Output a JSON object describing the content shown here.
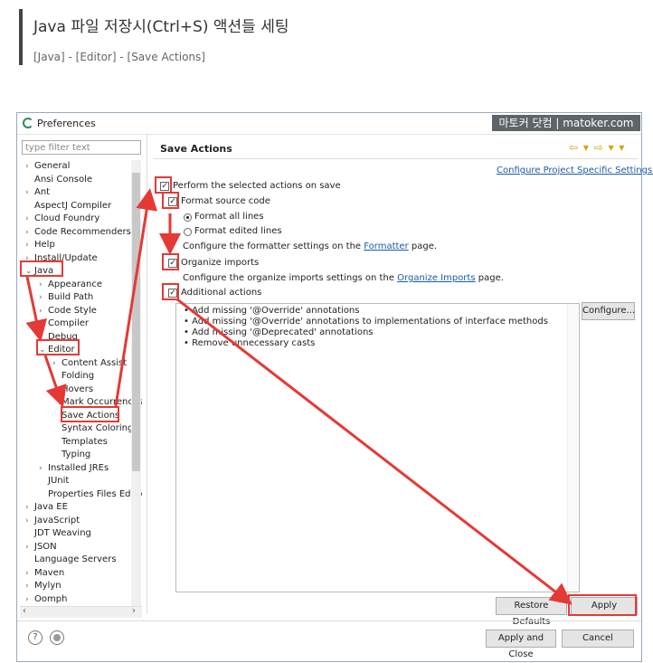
{
  "blog": {
    "title": "Java 파일 저장시(Ctrl+S) 액션들 세팅",
    "breadcrumb": "[Java] - [Editor] - [Save Actions]"
  },
  "window": {
    "title": "Preferences",
    "watermark": "마토커 닷컴 | matoker.com"
  },
  "sidebar": {
    "filter_placeholder": "type filter text",
    "items": [
      {
        "label": "General",
        "toggle": ">"
      },
      {
        "label": "Ansi Console",
        "toggle": ""
      },
      {
        "label": "Ant",
        "toggle": ">"
      },
      {
        "label": "AspectJ Compiler",
        "toggle": ""
      },
      {
        "label": "Cloud Foundry",
        "toggle": ">"
      },
      {
        "label": "Code Recommenders",
        "toggle": ">"
      },
      {
        "label": "Help",
        "toggle": ">"
      },
      {
        "label": "Install/Update",
        "toggle": ">"
      },
      {
        "label": "Java",
        "toggle": "v"
      },
      {
        "label": "Appearance",
        "toggle": ">"
      },
      {
        "label": "Build Path",
        "toggle": ">"
      },
      {
        "label": "Code Style",
        "toggle": ">"
      },
      {
        "label": "Compiler",
        "toggle": ">"
      },
      {
        "label": "Debug",
        "toggle": ">"
      },
      {
        "label": "Editor",
        "toggle": "v"
      },
      {
        "label": "Content Assist",
        "toggle": ">"
      },
      {
        "label": "Folding",
        "toggle": ""
      },
      {
        "label": "Hovers",
        "toggle": ""
      },
      {
        "label": "Mark Occurrences",
        "toggle": ""
      },
      {
        "label": "Save Actions",
        "toggle": ""
      },
      {
        "label": "Syntax Coloring",
        "toggle": ""
      },
      {
        "label": "Templates",
        "toggle": ""
      },
      {
        "label": "Typing",
        "toggle": ""
      },
      {
        "label": "Installed JREs",
        "toggle": ">"
      },
      {
        "label": "JUnit",
        "toggle": ""
      },
      {
        "label": "Properties Files Editor",
        "toggle": ""
      },
      {
        "label": "Java EE",
        "toggle": ">"
      },
      {
        "label": "JavaScript",
        "toggle": ">"
      },
      {
        "label": "JDT Weaving",
        "toggle": ""
      },
      {
        "label": "JSON",
        "toggle": ">"
      },
      {
        "label": "Language Servers",
        "toggle": ""
      },
      {
        "label": "Maven",
        "toggle": ">"
      },
      {
        "label": "Mylyn",
        "toggle": ">"
      },
      {
        "label": "Oomph",
        "toggle": ">"
      }
    ]
  },
  "main": {
    "title": "Save Actions",
    "nav": "⇦ ▾ ⇨ ▾ ▾",
    "configure_project_link": "Configure Project Specific Settings...",
    "perform_label": "Perform the selected actions on save",
    "format_label": "Format source code",
    "format_all_label": "Format all lines",
    "format_edited_label": "Format edited lines",
    "formatter_prefix": "Configure the formatter settings on the",
    "formatter_link": "Formatter",
    "formatter_suffix": "page.",
    "organize_label": "Organize imports",
    "organize_prefix": "Configure the organize imports settings on the",
    "organize_link": "Organize Imports",
    "organize_suffix": "page.",
    "additional_label": "Additional actions",
    "actions": [
      "Add missing '@Override' annotations",
      "Add missing '@Override' annotations to implementations of interface methods",
      "Add missing '@Deprecated' annotations",
      "Remove unnecessary casts"
    ],
    "configure_btn": "Configure...",
    "restore_btn": "Restore Defaults",
    "apply_btn": "Apply"
  },
  "footer": {
    "help_glyph": "?",
    "apply_close_btn": "Apply and Close",
    "cancel_btn": "Cancel"
  }
}
